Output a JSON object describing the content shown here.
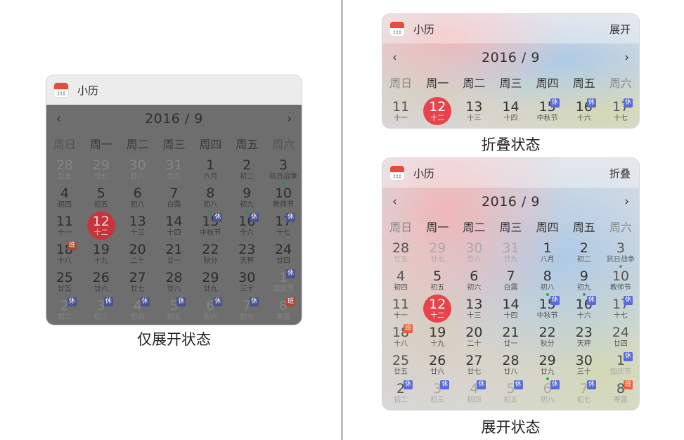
{
  "app_name": "小历",
  "weekdays": [
    "周日",
    "周一",
    "周二",
    "周三",
    "周四",
    "周五",
    "周六"
  ],
  "month_label": "2016 / 9",
  "prev_label": "‹",
  "next_label": "›",
  "icon": "calendar-app-icon",
  "colors": {
    "today": "#e8434c",
    "holiday_tag": "#5b6bd6",
    "work_tag": "#e8603c",
    "event_dot": "#27ae60"
  },
  "widgets": {
    "left": {
      "caption": "仅展开状态",
      "toggle": ""
    },
    "folded": {
      "caption": "折叠状态",
      "toggle": "展开"
    },
    "expanded": {
      "caption": "展开状态",
      "toggle": "折叠"
    }
  },
  "folded_week": [
    {
      "day": "11",
      "lunar": "十一"
    },
    {
      "day": "12",
      "lunar": "十二",
      "today": true
    },
    {
      "day": "13",
      "lunar": "十三"
    },
    {
      "day": "14",
      "lunar": "十四"
    },
    {
      "day": "15",
      "lunar": "中秋节",
      "tag": "休"
    },
    {
      "day": "16",
      "lunar": "十六",
      "tag": "休"
    },
    {
      "day": "17",
      "lunar": "十七",
      "tag": "休"
    }
  ],
  "expanded_days": [
    {
      "day": "28",
      "lunar": "廿五",
      "dim": true
    },
    {
      "day": "29",
      "lunar": "廿七",
      "dim": true
    },
    {
      "day": "30",
      "lunar": "廿八",
      "dim": true
    },
    {
      "day": "31",
      "lunar": "廿九",
      "dim": true
    },
    {
      "day": "1",
      "lunar": "八月"
    },
    {
      "day": "2",
      "lunar": "初二"
    },
    {
      "day": "3",
      "lunar": "抗日战争",
      "festival": true,
      "dot": true
    },
    {
      "day": "4",
      "lunar": "初四"
    },
    {
      "day": "5",
      "lunar": "初五"
    },
    {
      "day": "6",
      "lunar": "初六"
    },
    {
      "day": "7",
      "lunar": "白露"
    },
    {
      "day": "8",
      "lunar": "初八",
      "dot": true
    },
    {
      "day": "9",
      "lunar": "初九",
      "dot": true
    },
    {
      "day": "10",
      "lunar": "教师节",
      "festival": true
    },
    {
      "day": "11",
      "lunar": "十一"
    },
    {
      "day": "12",
      "lunar": "十二",
      "today": true
    },
    {
      "day": "13",
      "lunar": "十三"
    },
    {
      "day": "14",
      "lunar": "十四"
    },
    {
      "day": "15",
      "lunar": "中秋节",
      "tag": "休"
    },
    {
      "day": "16",
      "lunar": "十六",
      "tag": "休"
    },
    {
      "day": "17",
      "lunar": "十七",
      "tag": "休"
    },
    {
      "day": "18",
      "lunar": "十八",
      "tag": "班",
      "ban": true
    },
    {
      "day": "19",
      "lunar": "十九"
    },
    {
      "day": "20",
      "lunar": "二十"
    },
    {
      "day": "21",
      "lunar": "廿一"
    },
    {
      "day": "22",
      "lunar": "秋分"
    },
    {
      "day": "23",
      "lunar": "天秤"
    },
    {
      "day": "24",
      "lunar": "廿四"
    },
    {
      "day": "25",
      "lunar": "廿五"
    },
    {
      "day": "26",
      "lunar": "廿六"
    },
    {
      "day": "27",
      "lunar": "廿七"
    },
    {
      "day": "28",
      "lunar": "廿八"
    },
    {
      "day": "29",
      "lunar": "廿九",
      "dot": true
    },
    {
      "day": "30",
      "lunar": "三十"
    },
    {
      "day": "1",
      "lunar": "国庆节",
      "dim": true,
      "tag": "休"
    },
    {
      "day": "2",
      "lunar": "初二",
      "dim": true,
      "tag": "休"
    },
    {
      "day": "3",
      "lunar": "初三",
      "dim": true,
      "tag": "休"
    },
    {
      "day": "4",
      "lunar": "初四",
      "dim": true,
      "tag": "休"
    },
    {
      "day": "5",
      "lunar": "初五",
      "dim": true,
      "tag": "休"
    },
    {
      "day": "6",
      "lunar": "初六",
      "dim": true,
      "tag": "休"
    },
    {
      "day": "7",
      "lunar": "初七",
      "dim": true,
      "tag": "休"
    },
    {
      "day": "8",
      "lunar": "寒露",
      "dim": true,
      "tag": "班",
      "ban": true
    }
  ],
  "left_days": [
    {
      "day": "28",
      "lunar": "廿五",
      "dim": true
    },
    {
      "day": "29",
      "lunar": "廿七",
      "dim": true
    },
    {
      "day": "30",
      "lunar": "廿八",
      "dim": true
    },
    {
      "day": "31",
      "lunar": "廿九",
      "dim": true
    },
    {
      "day": "1",
      "lunar": "八月"
    },
    {
      "day": "2",
      "lunar": "初二"
    },
    {
      "day": "3",
      "lunar": "抗日战争",
      "festival": true,
      "dot": true
    },
    {
      "day": "4",
      "lunar": "初四"
    },
    {
      "day": "5",
      "lunar": "初五"
    },
    {
      "day": "6",
      "lunar": "初六"
    },
    {
      "day": "7",
      "lunar": "白露"
    },
    {
      "day": "8",
      "lunar": "初八",
      "dot": true
    },
    {
      "day": "9",
      "lunar": "初九",
      "dot": true
    },
    {
      "day": "10",
      "lunar": "教师节",
      "festival": true
    },
    {
      "day": "11",
      "lunar": "十一"
    },
    {
      "day": "12",
      "lunar": "十二",
      "today": true
    },
    {
      "day": "13",
      "lunar": "十三"
    },
    {
      "day": "14",
      "lunar": "十四"
    },
    {
      "day": "15",
      "lunar": "中秋节",
      "tag": "休"
    },
    {
      "day": "16",
      "lunar": "十六",
      "tag": "休"
    },
    {
      "day": "17",
      "lunar": "十七",
      "tag": "休"
    },
    {
      "day": "18",
      "lunar": "十八",
      "tag": "班",
      "ban": true
    },
    {
      "day": "19",
      "lunar": "十九"
    },
    {
      "day": "20",
      "lunar": "二十"
    },
    {
      "day": "21",
      "lunar": "廿一"
    },
    {
      "day": "22",
      "lunar": "秋分"
    },
    {
      "day": "23",
      "lunar": "天秤"
    },
    {
      "day": "24",
      "lunar": "廿四"
    },
    {
      "day": "25",
      "lunar": "廿五"
    },
    {
      "day": "26",
      "lunar": "廿六"
    },
    {
      "day": "27",
      "lunar": "廿七"
    },
    {
      "day": "28",
      "lunar": "廿八"
    },
    {
      "day": "29",
      "lunar": "廿九",
      "dot": true
    },
    {
      "day": "30",
      "lunar": "三十"
    },
    {
      "day": "1",
      "lunar": "国庆节",
      "dim": true,
      "tag": "休"
    },
    {
      "day": "2",
      "lunar": "初二",
      "dim": true,
      "tag": "休"
    },
    {
      "day": "3",
      "lunar": "初三",
      "dim": true,
      "tag": "休"
    },
    {
      "day": "4",
      "lunar": "初四",
      "dim": true,
      "tag": "休"
    },
    {
      "day": "5",
      "lunar": "初五",
      "dim": true,
      "tag": "休"
    },
    {
      "day": "6",
      "lunar": "初六",
      "dim": true,
      "tag": "休"
    },
    {
      "day": "7",
      "lunar": "初七",
      "dim": true,
      "tag": "休"
    },
    {
      "day": "8",
      "lunar": "寒露",
      "dim": true,
      "tag": "班",
      "ban": true
    }
  ]
}
